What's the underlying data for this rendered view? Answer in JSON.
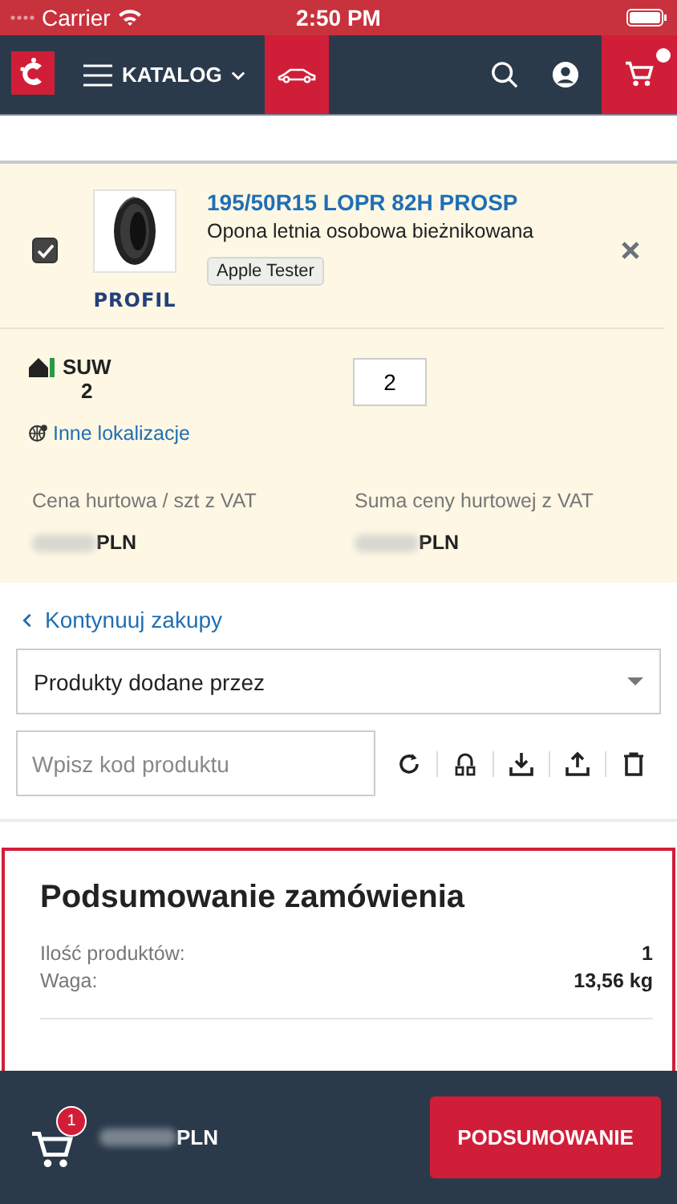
{
  "status_bar": {
    "carrier": "Carrier",
    "time": "2:50 PM"
  },
  "nav": {
    "menu_label": "KATALOG",
    "cart_has_items": true
  },
  "cart_item": {
    "checked": true,
    "title": "195/50R15 LOPR 82H PROSP",
    "description": "Opona letnia osobowa bieżnikowana",
    "tag": "Apple Tester",
    "brand": "PROFIL",
    "warehouse": "SUW",
    "stock": "2",
    "other_locations": "Inne lokalizacje",
    "quantity": "2",
    "price_label": "Cena hurtowa / szt z VAT",
    "price_currency": "PLN",
    "sum_label": "Suma ceny hurtowej z VAT",
    "sum_currency": "PLN"
  },
  "continue_link": "Kontynuuj zakupy",
  "filter": {
    "value": "Produkty dodane przez"
  },
  "code_input": {
    "placeholder": "Wpisz kod produktu"
  },
  "summary": {
    "title": "Podsumowanie zamówienia",
    "rows": [
      {
        "label": "Ilość produktów:",
        "value": "1"
      },
      {
        "label": "Waga:",
        "value": "13,56 kg"
      }
    ]
  },
  "footer": {
    "cart_count": "1",
    "total_currency": "PLN",
    "button": "PODSUMOWANIE"
  }
}
